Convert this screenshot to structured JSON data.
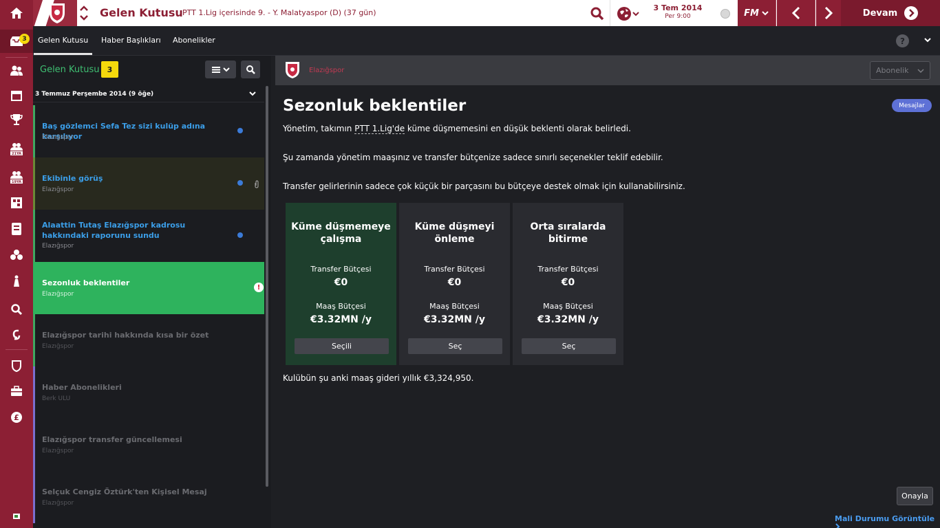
{
  "header": {
    "title": "Gelen Kutusu",
    "subtitle": "PTT 1.Lig içerisinde 9. - Y. Malatyaspor (D) (37 gün)",
    "date": "3 Tem 2014",
    "day": "Per 9:00",
    "fm_label": "FM",
    "continue_label": "Devam"
  },
  "rail": {
    "inbox_badge": "3"
  },
  "subnav": {
    "tabs": [
      {
        "label": "Gelen Kutusu"
      },
      {
        "label": "Haber Başlıkları"
      },
      {
        "label": "Abonelikler"
      }
    ],
    "help": "?"
  },
  "inbox": {
    "title": "Gelen Kutusu",
    "count": "3",
    "group_label": "3 Temmuz Perşembe 2014 (9 öğe)",
    "messages": [
      {
        "title": "Baş gözlemci Sefa Tez sizi kulüp adına karşılıyor",
        "from": "Elazığspor"
      },
      {
        "title": "Ekibinle görüş",
        "from": "Elazığspor"
      },
      {
        "title": "Alaattin Tutaş Elazığspor kadrosu hakkındaki raporunu sundu",
        "from": "Elazığspor"
      },
      {
        "title": "Sezonluk beklentiler",
        "from": "Elazığspor"
      },
      {
        "title": "Elazığspor tarihi hakkında kısa bir özet",
        "from": "Elazığspor"
      },
      {
        "title": "Haber Abonelikleri",
        "from": "Berk ULU"
      },
      {
        "title": "Elazığspor transfer güncellemesi",
        "from": "Elazığspor"
      },
      {
        "title": "Selçuk Cengiz Öztürk'ten Kişisel Mesaj",
        "from": "Elazığspor"
      }
    ]
  },
  "detail": {
    "club": "Elazığspor",
    "subscription_label": "Abonelik",
    "messages_button": "Mesajlar",
    "heading": "Sezonluk beklentiler",
    "p1_pre": "Yönetim, takımın ",
    "p1_link": "PTT 1.Lig'de",
    "p1_post": " küme düşmemesini en düşük beklenti olarak belirledi.",
    "p2": "Şu zamanda yönetim maaşınız ve transfer bütçenize sadece sınırlı seçenekler teklif edebilir.",
    "p3": "Transfer gelirlerinin sadece çok küçük bir parçasını bu bütçeye destek olmak için kullanabilirsiniz.",
    "options": [
      {
        "title": "Küme düşmemeye çalışma",
        "transfer_label": "Transfer Bütçesi",
        "transfer_value": "€0",
        "wage_label": "Maaş Bütçesi",
        "wage_value": "€3.32MN /y",
        "button": "Seçili"
      },
      {
        "title": "Küme düşmeyi önleme",
        "transfer_label": "Transfer Bütçesi",
        "transfer_value": "€0",
        "wage_label": "Maaş Bütçesi",
        "wage_value": "€3.32MN /y",
        "button": "Seç"
      },
      {
        "title": "Orta sıralarda bitirme",
        "transfer_label": "Transfer Bütçesi",
        "transfer_value": "€0",
        "wage_label": "Maaş Bütçesi",
        "wage_value": "€3.32MN /y",
        "button": "Seç"
      }
    ],
    "wage_note": "Kulübün şu anki maaş gideri yıllık €3,324,950.",
    "approve_label": "Onayla",
    "finance_link": "Mali Durumu Görüntüle"
  },
  "colors": {
    "brand": "#8c1f34",
    "accent_green": "#2eb35d",
    "link_blue": "#3b9ee8",
    "badge_yellow": "#f5d90c"
  },
  "icons": [
    "home-icon",
    "inbox-icon",
    "people-icon",
    "calendar-icon",
    "trophy-icon",
    "youth-icon",
    "staff-icon",
    "tactics-icon",
    "document-icon",
    "training-icon",
    "medical-icon",
    "search-icon",
    "transfer-icon",
    "shield-icon",
    "briefcase-icon",
    "pound-icon",
    "globe-icon",
    "football-icon",
    "paperclip-icon",
    "warning-icon"
  ]
}
